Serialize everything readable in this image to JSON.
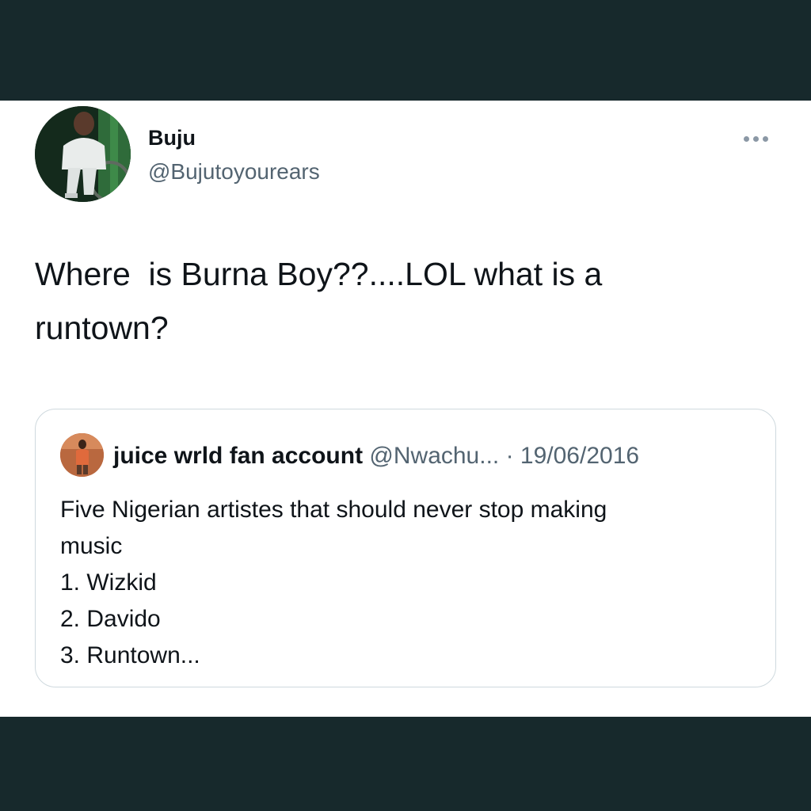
{
  "tweet": {
    "display_name": "Buju",
    "handle": "@Bujutoyourears",
    "more_icon": "more-horizontal-icon",
    "text_line1": "Where  is Burna Boy??....LOL what is a",
    "text_line2": "runtown?"
  },
  "quoted_tweet": {
    "display_name": "juice wrld fan account",
    "handle": "@Nwachu...",
    "separator": " · ",
    "date": "19/06/2016",
    "lines": [
      "Five Nigerian artistes that should never stop making",
      "music",
      "1. Wizkid",
      "2. Davido",
      "3. Runtown..."
    ]
  },
  "colors": {
    "background_band": "#17292c",
    "card": "#ffffff",
    "text_primary": "#0f1419",
    "text_secondary": "#536471",
    "quote_border": "#cfd9de"
  }
}
